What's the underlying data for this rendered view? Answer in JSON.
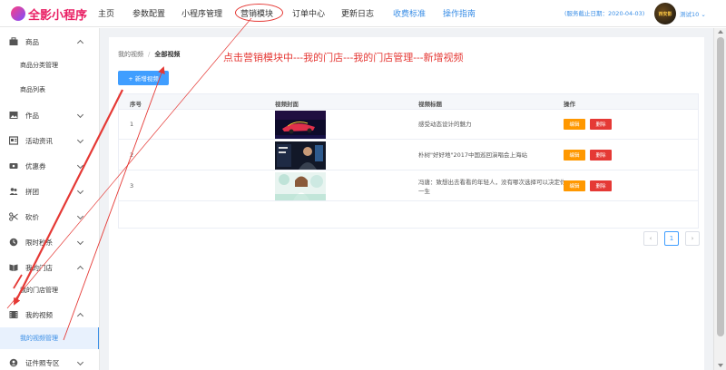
{
  "header": {
    "logo": "全影小程序",
    "nav": [
      {
        "label": "主页"
      },
      {
        "label": "参数配置"
      },
      {
        "label": "小程序管理"
      },
      {
        "label": "营销模块"
      },
      {
        "label": "订单中心"
      },
      {
        "label": "更新日志"
      },
      {
        "label": "收费标准"
      },
      {
        "label": "操作指南"
      }
    ],
    "service_info": "(服务截止日期：2020-04-03)",
    "avatar_text": "西安影",
    "user": "测试10 ⌄"
  },
  "sidebar": {
    "items": [
      {
        "label": "商品"
      },
      {
        "label": "商品分类管理"
      },
      {
        "label": "商品列表"
      },
      {
        "label": "作品"
      },
      {
        "label": "活动资讯"
      },
      {
        "label": "优惠券"
      },
      {
        "label": "拼团"
      },
      {
        "label": "砍价"
      },
      {
        "label": "限时秒杀"
      },
      {
        "label": "我的门店"
      },
      {
        "label": "我的门店管理"
      },
      {
        "label": "我的视频"
      },
      {
        "label": "我的视频管理"
      },
      {
        "label": "证件照专区"
      }
    ]
  },
  "main": {
    "breadcrumb": {
      "parent": "我的视频",
      "separator": "/",
      "current": "全部视频"
    },
    "instruction": "点击营销模块中---我的门店---我的门店管理---新增视频",
    "add_button": "+ 新增视频",
    "table": {
      "headers": [
        "序号",
        "视频封面",
        "视频标题",
        "操作"
      ],
      "rows": [
        {
          "num": "1",
          "title": "感受动态设计的魅力"
        },
        {
          "num": "2",
          "title": "朴树\"好好地\"2017中国巡回演唱会上海站"
        },
        {
          "num": "3",
          "title": "冯唐：致想出去看看的年轻人，没有哪次选择可以决定你一生"
        }
      ],
      "edit_label": "编辑",
      "delete_label": "删除"
    },
    "pagination": {
      "prev": "‹",
      "current": "1",
      "next": "›"
    }
  },
  "colors": {
    "primary": "#409eff",
    "edit": "#ff9800",
    "delete": "#e53935",
    "annotation": "#e53935",
    "logo": "#e91e63"
  }
}
